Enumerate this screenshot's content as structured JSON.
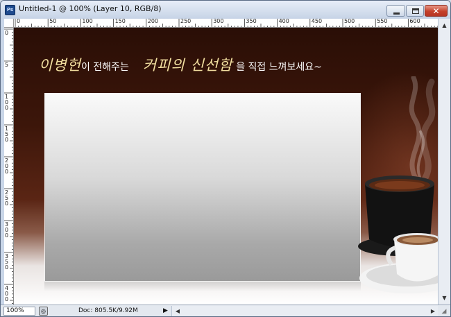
{
  "window": {
    "title": "Untitled-1 @ 100% (Layer 10, RGB/8)",
    "app_icon_text": "Ps",
    "close_glyph": "✕"
  },
  "rulers": {
    "horizontal_labels": [
      "0",
      "50",
      "100",
      "150",
      "200",
      "250",
      "300",
      "350",
      "400",
      "450",
      "500",
      "550",
      "600"
    ],
    "vertical_labels": [
      "0",
      "5",
      "100",
      "150",
      "200",
      "250",
      "300",
      "350",
      "400"
    ]
  },
  "canvas": {
    "headline": {
      "name": "이병헌",
      "text1": "이 전해주는",
      "coffee": "커피의 신선함",
      "text2": "을 직접 느껴보세요~"
    },
    "colors": {
      "background_dark": "#2a0e06",
      "accent_text": "#f2dfa0"
    }
  },
  "status": {
    "zoom": "100%",
    "doc_info": "Doc: 805.5K/9.92M",
    "menu_arrow": "▶",
    "scroll_left": "◀",
    "scroll_right": "▶",
    "scroll_up": "▲",
    "scroll_down": "▼"
  }
}
